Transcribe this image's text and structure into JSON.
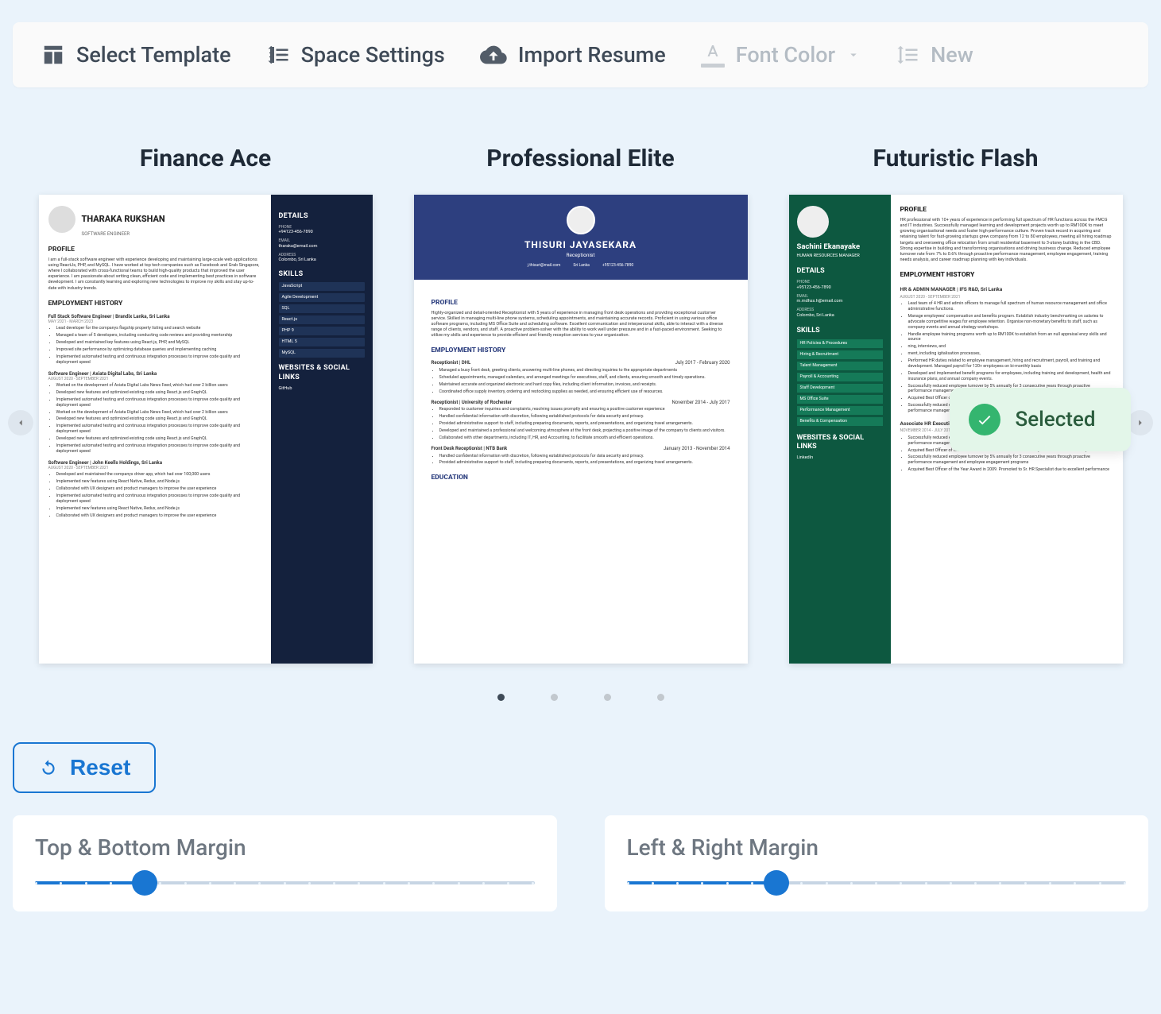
{
  "toolbar": {
    "select_template": "Select Template",
    "space_settings": "Space Settings",
    "import_resume": "Import Resume",
    "font_color": "Font Color",
    "new": "New"
  },
  "templates": [
    {
      "title": "Finance Ace",
      "name": "THARAKA RUKSHAN",
      "role": "SOFTWARE ENGINEER",
      "sections": {
        "profile_h": "PROFILE",
        "profile": "I am a full-stack software engineer with experience developing and maintaining large-scale web applications using ReactJs, PHP, and MySQL. I have worked at top tech companies such as Facebook and Grab Singapore, where I collaborated with cross-functional teams to build high-quality products that improved the user experience. I am passionate about writing clean, efficient code and implementing best practices in software development. I am constantly learning and exploring new technologies to improve my skills and stay up-to-date with industry trends.",
        "emp_h": "EMPLOYMENT HISTORY",
        "jobs": [
          {
            "t": "Full Stack Software Engineer | Brandix Lanka, Sri Lanka",
            "d": "MAY 2021 - MARCH 2023",
            "b": [
              "Lead developer for the companys flagship property listing and search website",
              "Managed a team of 5 developers, including conducting code reviews and providing mentorship",
              "Developed and maintained key features using React.js, PHP, and MySQL",
              "Improved site performance by optimizing database queries and implementing caching",
              "Implemented automated testing and continuous integration processes to improve code quality and deployment speed"
            ]
          },
          {
            "t": "Software Engineer | Axiata Digital Labs, Sri Lanka",
            "d": "AUGUST 2020 - SEPTEMBER 2021",
            "b": [
              "Worked on the development of Axiata Digital Labs News Feed, which had over 2 billion users",
              "Developed new features and optimized existing code using React.js and GraphQL",
              "Implemented automated testing and continuous integration processes to improve code quality and deployment speed",
              "Worked on the development of Axiata Digital Labs News Feed, which had over 2 billion users",
              "Developed new features and optimized existing code using React.js and GraphQL",
              "Implemented automated testing and continuous integration processes to improve code quality and deployment speed",
              "Developed new features and optimized existing code using React.js and GraphQL",
              "Implemented automated testing and continuous integration processes to improve code quality and deployment speed"
            ]
          },
          {
            "t": "Software Engineer | John Keells Holdings, Sri Lanka",
            "d": "AUGUST 2020 - SEPTEMBER 2021",
            "b": [
              "Developed and maintained the companys driver app, which had over 100,000 users",
              "Implemented new features using React Native, Redux, and Node.js",
              "Collaborated with UX designers and product managers to improve the user experience",
              "Implemented automated testing and continuous integration processes to improve code quality and deployment speed",
              "Implemented new features using React Native, Redux, and Node.js",
              "Collaborated with UX designers and product managers to improve the user experience"
            ]
          }
        ]
      },
      "side": {
        "details_h": "DETAILS",
        "phone_l": "PHONE",
        "phone": "+94123-456-7890",
        "email_l": "EMAIL",
        "email": "tharaka@email.com",
        "addr_l": "ADDRESS",
        "addr": "Colombo, Sri Lanka",
        "skills_h": "SKILLS",
        "skills": [
          "JavaScript",
          "Agile Development",
          "SQL",
          "React.js",
          "PHP 9",
          "HTML 5",
          "MySQL"
        ],
        "links_h": "WEBSITES & SOCIAL LINKS",
        "links": [
          "GitHub"
        ]
      }
    },
    {
      "title": "Professional Elite",
      "name": "THISURI JAYASEKARA",
      "role": "Receptionist",
      "meta": [
        "j.thisuri@mail.com",
        "Sri Lanka",
        "+95123-456-7890"
      ],
      "sections": {
        "profile_h": "PROFILE",
        "profile": "Highly-organized and detail-oriented Receptionist with 5 years of experience in managing front desk operations and providing exceptional customer service. Skilled in managing multi-line phone systems, scheduling appointments, and maintaining accurate records. Proficient in using various office software programs, including MS Office Suite and scheduling software. Excellent communication and interpersonal skills, able to interact with a diverse range of clients, vendors, and staff. A proactive problem-solver with the ability to work well under pressure and in a fast-paced environment. Seeking to utilize my skills and experience to provide efficient and friendly reception services to your organization.",
        "emp_h": "EMPLOYMENT HISTORY",
        "jobs": [
          {
            "t": "Receptionist | DHL",
            "d": "July 2017 - February 2020",
            "b": [
              "Managed a busy front desk, greeting clients, answering multi-line phones, and directing inquiries to the appropriate departments",
              "Scheduled appointments, managed calendars, and arranged meetings for executives, staff, and clients, ensuring smooth and timely operations.",
              "Maintained accurate and organized electronic and hard copy files, including client information, invoices, and receipts.",
              "Coordinated office supply inventory, ordering and restocking supplies as needed, and ensuring efficient use of resources."
            ]
          },
          {
            "t": "Receptionist | University of Rochester",
            "d": "November 2014 - July 2017",
            "b": [
              "Responded to customer inquiries and complaints, resolving issues promptly and ensuring a positive customer experience",
              "Handled confidential information with discretion, following established protocols for data security and privacy.",
              "Provided administrative support to staff, including preparing documents, reports, and presentations, and organizing travel arrangements.",
              "Developed and maintained a professional and welcoming atmosphere at the front desk, projecting a positive image of the company to clients and visitors.",
              "Collaborated with other departments, including IT, HR, and Accounting, to facilitate smooth and efficient operations."
            ]
          },
          {
            "t": "Front Desk Receptionist | NTB Bank",
            "d": "January 2013 - November 2014",
            "b": [
              "Handled confidential information with discretion, following established protocols for data security and privacy.",
              "Provided administrative support to staff, including preparing documents, reports, and presentations, and organizing travel arrangements."
            ]
          }
        ],
        "edu_h": "EDUCATION"
      }
    },
    {
      "title": "Futuristic Flash",
      "name": "Sachini Ekanayake",
      "role": "HUMAN RESOURCES MANAGER",
      "side": {
        "details_h": "DETAILS",
        "phone_l": "PHONE",
        "phone": "+95123-456-7890",
        "email_l": "EMAIL",
        "email": "m.mdhsx.h@email.com",
        "addr_l": "ADDRESS",
        "addr": "Colombo, Sri Lanka",
        "skills_h": "SKILLS",
        "skills": [
          "HR Policies & Procedures",
          "Hiring & Recruitment",
          "Talent Management",
          "Payroll & Accounting",
          "Staff Development",
          "MS Office Suite",
          "Performance Management",
          "Benefits & Compensation"
        ],
        "links_h": "WEBSITES & SOCIAL LINKS",
        "links": [
          "LinkedIn"
        ]
      },
      "sections": {
        "profile_h": "PROFILE",
        "profile": "HR professional with 10+ years of experience in performing full spectrum of HR functions across the FMCG and IT industries. Successfully managed learning and development projects worth up to RM100K to meet growing organisational needs and foster high-performance culture. Proven track record in acquiring and retaining talent for fast-growing startups grew company from 12 to 80 employees, meeting all hiring roadmap targets and overseeing office relocation from small residential basement to 3-storey building in the CBD. Strong expertise in building and transforming organisations and driving business change. Reduced employee turnover rate from 7% to 0.6% through proactive performance management, employee engagement, training needs analysis, and career roadmap planning with key individuals.",
        "emp_h": "EMPLOYMENT HISTORY",
        "jobs": [
          {
            "t": "HR & ADMIN MANAGER | IFS R&D, Sri Lanka",
            "d": "AUGUST 2020 - SEPTEMBER 2021",
            "b": [
              "Lead team of 4 HR and admin officers to manage full spectrum of human resource management and office administrative functions.",
              "Manage employees' compensation and benefits program. Establish industry benchmarking on salaries to advocate competitive wages for employee retention. Organise non-monetary benefits to staff, such as company events and annual strategy workshops.",
              "Handle employee training programs worth up to RM100K to establish from an null appraisal ency skills and source",
              "ning, interviews, and",
              "ment, including igitalisation processes,",
              "Performed HR duties related to employee management, hiring and recruitment, payroll, and training and development. Managed payroll for 120+ employees on bi-monthly basis",
              "Developed and implemented benefit programs for employees, including training and development, health and insurance plans, and annual company events.",
              "Successfully reduced employee turnover by 5% annually for 3 consecutive years through proactive performance management and employee engagement programs",
              "Acquired Best Officer of the Year Award in 2009. Promoted to Sr. HR Specialist due to excellent performance.",
              "Successfully reduced employee turnover by 5% annually for 3 consecutive years through proactive performance management and employee engagement programs"
            ]
          },
          {
            "t": "Associate HR Executive | Dialog Axiata, Sri Lanka",
            "d": "NOVEMBER 2014 - JULY 2017",
            "b": [
              "Successfully reduced employee turnover by 5% annually for 3 consecutive years through proactive performance management and employee engagement programs",
              "Acquired Best Officer of the Year Award in 2009. Promoted to Sr. HR Specialist due to excellent performance.",
              "Successfully reduced employee turnover by 5% annually for 3 consecutive years through proactive performance management and employee engagement programs",
              "Acquired Best Officer of the Year Award in 2009. Promoted to Sr. HR Specialist due to excellent performance"
            ]
          }
        ]
      },
      "selected_label": "Selected"
    }
  ],
  "pagination": {
    "total": 4,
    "active": 0
  },
  "reset_label": "Reset",
  "sliders": {
    "top_bottom": {
      "label": "Top & Bottom Margin",
      "value": 22
    },
    "left_right": {
      "label": "Left & Right Margin",
      "value": 30
    }
  }
}
